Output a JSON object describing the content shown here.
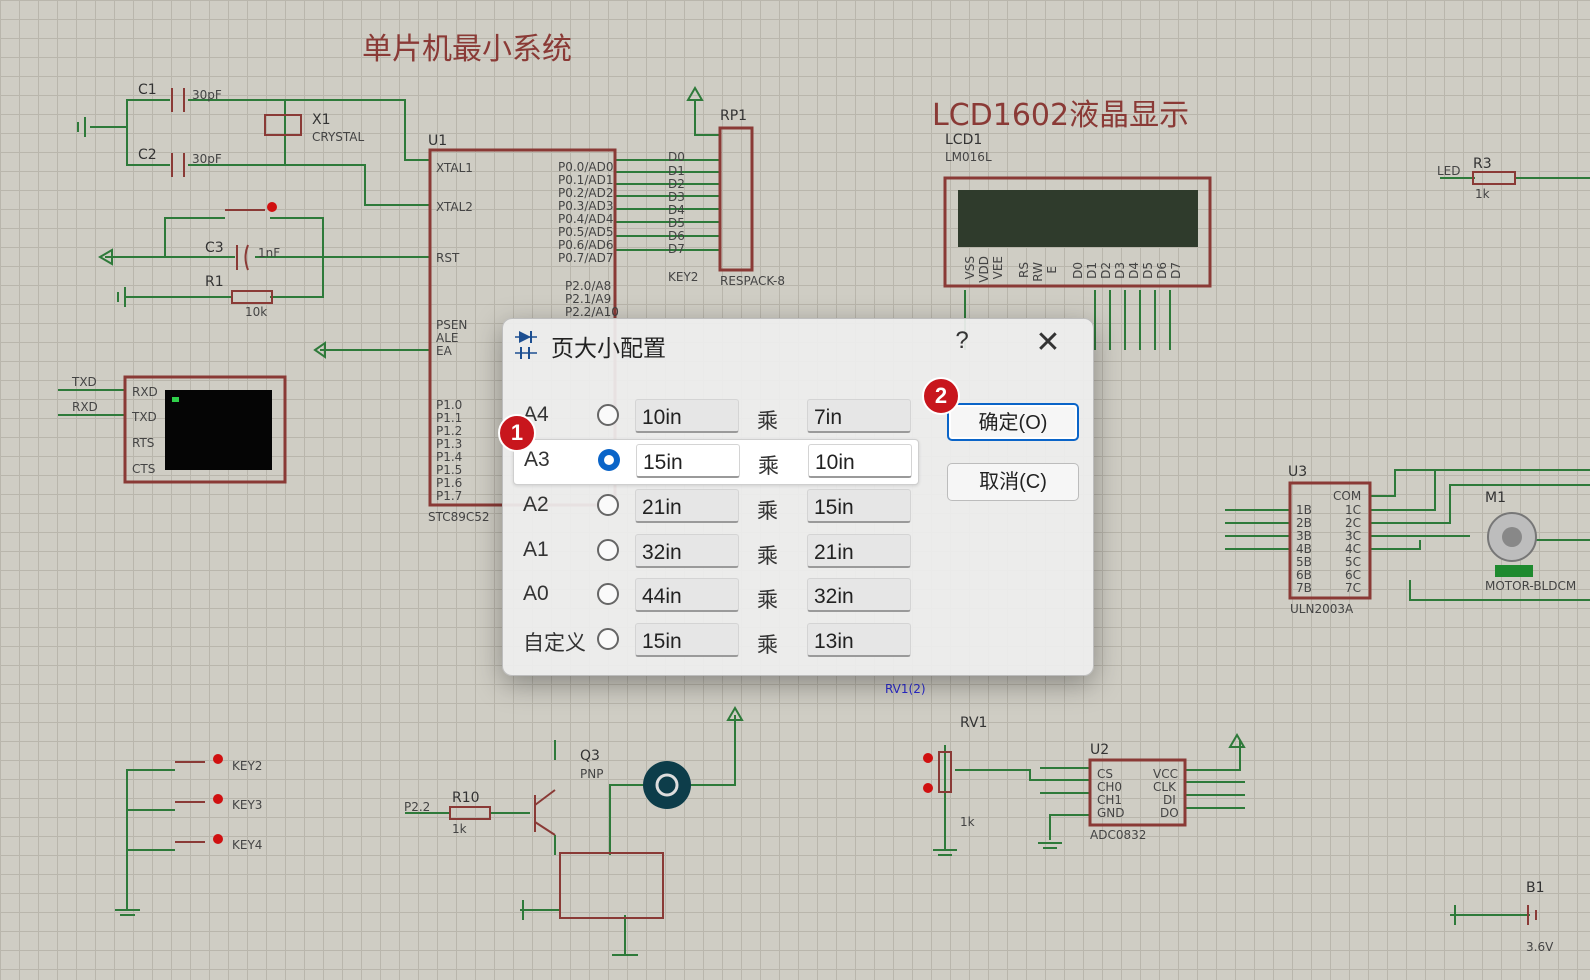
{
  "schematic": {
    "title_mcu": "单片机最小系统",
    "title_lcd": "LCD1602液晶显示",
    "labels": {
      "c1": "C1",
      "c1_val": "30pF",
      "c2": "C2",
      "c2_val": "30pF",
      "x1": "X1",
      "x1_val": "CRYSTAL",
      "u1": "U1",
      "u1_part": "STC89C52",
      "c3": "C3",
      "c3_val": "1nF",
      "r1": "R1",
      "r1_val": "10k",
      "rp1": "RP1",
      "rp1_part": "RESPACK-8",
      "lcd1": "LCD1",
      "lcd1_part": "LM016L",
      "r3": "R3",
      "r3_val": "1k",
      "led": "LED",
      "u3": "U3",
      "u3_part": "ULN2003A",
      "m1": "M1",
      "m1_part": "MOTOR-BLDCM",
      "q3": "Q3",
      "q3_type": "PNP",
      "r10": "R10",
      "r10_val": "1k",
      "p22": "P2.2",
      "rv1": "RV1",
      "rv1_val": "1k",
      "rv1_pin": "RV1(2)",
      "u2": "U2",
      "u2_part": "ADC0832",
      "b1": "B1",
      "b1_val": "3.6V",
      "key2": "KEY2",
      "key3": "KEY3",
      "key4": "KEY4",
      "txd": "TXD",
      "rxd": "RXD",
      "u1_pins_left": [
        "XTAL1",
        "XTAL2",
        "RST",
        "PSEN",
        "ALE",
        "EA",
        "P1.0",
        "P1.1",
        "P1.2",
        "P1.3",
        "P1.4",
        "P1.5",
        "P1.6",
        "P1.7"
      ],
      "u1_pins_right": [
        "P0.0/AD0",
        "P0.1/AD1",
        "P0.2/AD2",
        "P0.3/AD3",
        "P0.4/AD4",
        "P0.5/AD5",
        "P0.6/AD6",
        "P0.7/AD7",
        "P2.0/A8",
        "P2.1/A9",
        "P2.2/A10"
      ],
      "bus_labels": [
        "D0",
        "D1",
        "D2",
        "D3",
        "D4",
        "D5",
        "D6",
        "D7"
      ],
      "terminal_pins": [
        "RXD",
        "TXD",
        "RTS",
        "CTS"
      ],
      "u3_inputs": [
        "1B",
        "2B",
        "3B",
        "4B",
        "5B",
        "6B",
        "7B"
      ],
      "u3_outputs": [
        "COM",
        "1C",
        "2C",
        "3C",
        "4C",
        "5C",
        "6C",
        "7C"
      ],
      "u2_left": [
        "CS",
        "CH0",
        "CH1",
        "GND"
      ],
      "u2_right": [
        "VCC",
        "CLK",
        "DI",
        "DO"
      ],
      "lcd_pins": [
        "VSS",
        "VDD",
        "VEE",
        "RS",
        "RW",
        "E",
        "D0",
        "D1",
        "D2",
        "D3",
        "D4",
        "D5",
        "D6",
        "D7"
      ]
    }
  },
  "dialog": {
    "title": "页大小配置",
    "help_label": "?",
    "close_label": "✕",
    "times_label": "乘",
    "rows": [
      {
        "label": "A4",
        "width": "10in",
        "height": "7in",
        "selected": false
      },
      {
        "label": "A3",
        "width": "15in",
        "height": "10in",
        "selected": true
      },
      {
        "label": "A2",
        "width": "21in",
        "height": "15in",
        "selected": false
      },
      {
        "label": "A1",
        "width": "32in",
        "height": "21in",
        "selected": false
      },
      {
        "label": "A0",
        "width": "44in",
        "height": "32in",
        "selected": false
      },
      {
        "label": "自定义",
        "width": "15in",
        "height": "13in",
        "selected": false
      }
    ],
    "ok_label": "确定(O)",
    "cancel_label": "取消(C)"
  },
  "annotations": {
    "badge1": "1",
    "badge2": "2"
  },
  "colors": {
    "accent": "#0a64c8",
    "badge": "#c8161d",
    "wire": "#2e7a3a",
    "component": "#8a3a36"
  }
}
